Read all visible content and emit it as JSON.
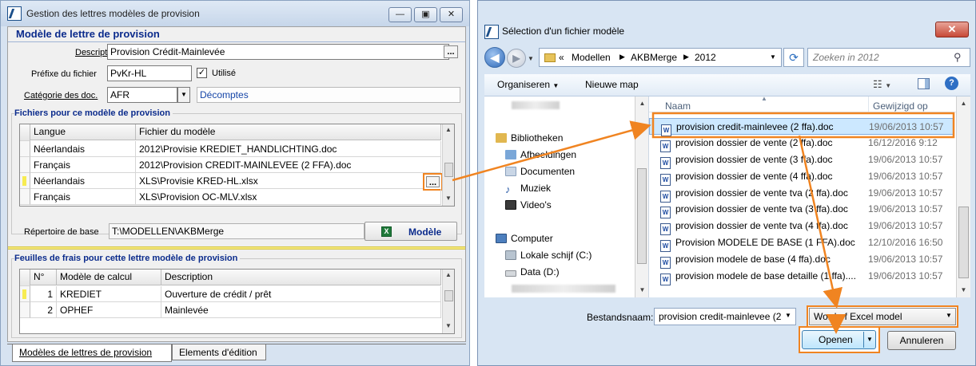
{
  "left_window": {
    "title": "Gestion des lettres modèles de provision",
    "title_buttons": [
      "—",
      "▣",
      "✕"
    ],
    "section_title": "Modèle de lettre de provision",
    "description_label": "Description",
    "description_value": "Provision Crédit-Mainlevée",
    "prefix_label": "Préfixe du fichier",
    "prefix_value": "PvKr-HL",
    "used_label": "Utilisé",
    "used_checked": true,
    "category_label": "Catégorie des doc.",
    "category_value": "AFR",
    "category_text": "Décomptes",
    "ellipsis": "...",
    "files_group_title": "Fichiers pour ce modèle de provision",
    "files_headers": [
      "Langue",
      "Fichier du modèle"
    ],
    "files_rows": [
      {
        "lang": "Néerlandais",
        "file": "2012\\Provisie KREDIET_HANDLICHTING.doc"
      },
      {
        "lang": "Français",
        "file": "2012\\Provision CREDIT-MAINLEVEE (2 FFA).doc"
      },
      {
        "lang": "Néerlandais",
        "file": "XLS\\Provisie KRED-HL.xlsx"
      },
      {
        "lang": "Français",
        "file": "XLS\\Provision OC-MLV.xlsx"
      }
    ],
    "base_dir_label": "Répertoire de base",
    "base_dir_value": "T:\\MODELLEN\\AKBMerge",
    "model_button": "Modèle",
    "fees_group_title": "Feuilles de frais pour cette lettre modèle de provision",
    "fees_headers": [
      "N°",
      "Modèle de calcul",
      "Description"
    ],
    "fees_rows": [
      {
        "n": "1",
        "model": "KREDIET",
        "desc": "Ouverture de crédit / prêt"
      },
      {
        "n": "2",
        "model": "OPHEF",
        "desc": "Mainlevée"
      }
    ],
    "tabs": [
      "Modèles de lettres de provision",
      "Elements d'édition"
    ]
  },
  "dialog": {
    "title": "Sélection d'un fichier modèle",
    "close": "✕",
    "breadcrumb": [
      "«",
      "Modellen",
      "AKBMerge",
      "2012"
    ],
    "search_placeholder": "Zoeken in 2012",
    "organize_label": "Organiseren",
    "new_folder_label": "Nieuwe map",
    "nav": [
      {
        "label": "Bibliotheken",
        "icon": "library-icon",
        "indent": 0
      },
      {
        "label": "Afbeeldingen",
        "icon": "pictures-icon",
        "indent": 1
      },
      {
        "label": "Documenten",
        "icon": "documents-icon",
        "indent": 1
      },
      {
        "label": "Muziek",
        "icon": "music-icon",
        "indent": 1
      },
      {
        "label": "Video's",
        "icon": "videos-icon",
        "indent": 1
      },
      {
        "label": "Computer",
        "icon": "computer-icon",
        "indent": 0
      },
      {
        "label": "Lokale schijf (C:)",
        "icon": "local-disk-icon",
        "indent": 1
      },
      {
        "label": "Data (D:)",
        "icon": "data-disk-icon",
        "indent": 1
      }
    ],
    "col_name": "Naam",
    "col_modified": "Gewijzigd op",
    "files": [
      {
        "name": "provision credit-mainlevee (2 ffa).doc",
        "date": "19/06/2013 10:57"
      },
      {
        "name": "provision dossier de vente (2 ffa).doc",
        "date": "16/12/2016 9:12"
      },
      {
        "name": "provision dossier de vente (3 ffa).doc",
        "date": "19/06/2013 10:57"
      },
      {
        "name": "provision dossier de vente (4 ffa).doc",
        "date": "19/06/2013 10:57"
      },
      {
        "name": "provision dossier de vente tva (2 ffa).doc",
        "date": "19/06/2013 10:57"
      },
      {
        "name": "provision dossier de vente tva (3 ffa).doc",
        "date": "19/06/2013 10:57"
      },
      {
        "name": "provision dossier de vente tva (4 ffa).doc",
        "date": "19/06/2013 10:57"
      },
      {
        "name": "Provision MODELE DE BASE (1 FFA).doc",
        "date": "12/10/2016 16:50"
      },
      {
        "name": "provision modele de base (4 ffa).doc",
        "date": "19/06/2013 10:57"
      },
      {
        "name": "provision modele de base detaille (1 ffa)....",
        "date": "19/06/2013 10:57"
      }
    ],
    "filename_label": "Bestandsnaam:",
    "filename_value": "provision credit-mainlevee (2",
    "filter_value": "Word of Excel model",
    "open_label": "Openen",
    "cancel_label": "Annuleren"
  },
  "colors": {
    "highlight": "#f08421",
    "header_blue": "#0b2b8c",
    "selection": "#cce8ff"
  }
}
